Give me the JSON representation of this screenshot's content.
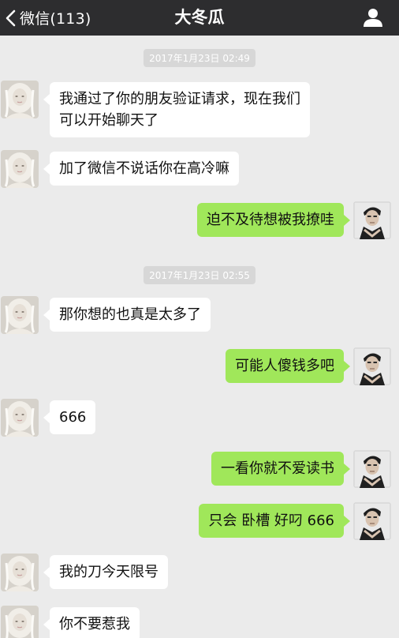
{
  "header": {
    "back_label": "微信(113)",
    "title": "大冬瓜"
  },
  "colors": {
    "header_bg": "#2d2d2f",
    "chat_bg": "#ebebeb",
    "incoming_bubble": "#ffffff",
    "outgoing_bubble": "#a0e75a",
    "timestamp_bg": "#d7d7d7"
  },
  "icons": {
    "back": "chevron-left-icon",
    "profile": "person-icon"
  },
  "timestamps": [
    "2017年1月23日 02:49",
    "2017年1月23日 02:55"
  ],
  "messages": [
    {
      "side": "in",
      "text": "我通过了你的朋友验证请求，现在我们可以开始聊天了"
    },
    {
      "side": "in",
      "text": "加了微信不说话你在高冷嘛"
    },
    {
      "side": "out",
      "text": "迫不及待想被我撩哇"
    },
    {
      "side": "in",
      "text": "那你想的也真是太多了"
    },
    {
      "side": "out",
      "text": "可能人傻钱多吧"
    },
    {
      "side": "in",
      "text": "666"
    },
    {
      "side": "out",
      "text": "一看你就不爱读书"
    },
    {
      "side": "out",
      "text": "只会 卧槽 好叼 666"
    },
    {
      "side": "in",
      "text": "我的刀今天限号"
    },
    {
      "side": "in",
      "text": "你不要惹我"
    }
  ]
}
